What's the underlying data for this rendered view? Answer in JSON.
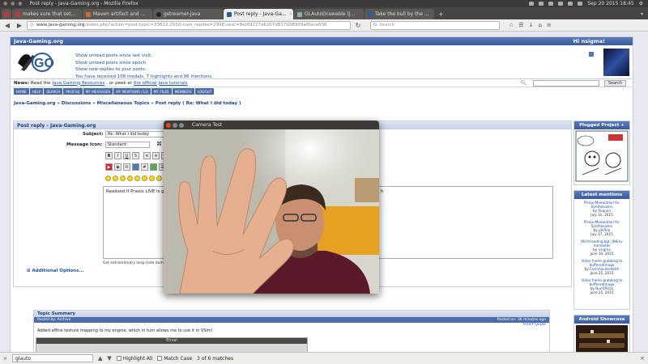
{
  "os": {
    "window_title": "Post reply - Java-Gaming.org - Mozilla Firefox",
    "clock": "Sep 20 2015 18:45"
  },
  "tabs": [
    {
      "label": "makes sure that set...",
      "icon": "gmail-icon"
    },
    {
      "label": "Maven artifact and ...",
      "icon": "maven-icon"
    },
    {
      "label": "gstreamer-java",
      "icon": "github-icon"
    },
    {
      "label": "Post reply - Java-Ga...",
      "icon": "jgo-icon",
      "active": true
    },
    {
      "label": "GLAutoDrawable (J...",
      "icon": "doc-icon"
    },
    {
      "label": "Take the bull by the ...",
      "icon": "jgo-icon"
    }
  ],
  "nav": {
    "url_host": "www.java-gaming.org",
    "url_path": "/index.php?action=post;topic=33622.2910;num_replies=2998;sesc=8e0fd227a6267d817d38909af0ace636",
    "search_placeholder": "Search"
  },
  "forum": {
    "site_name": "Java-Gaming.org",
    "greeting": "Hi nsigma!",
    "links": [
      "Show unread posts since last visit.",
      "Show unread posts since epoch.",
      "Show new replies to your posts.",
      "You have received 108 medals. 7 highlights and 96 mentions."
    ],
    "news_label": "News:",
    "news_text_1": "Read the",
    "news_link_1": "Java Gaming Resources",
    "news_text_2": ", or peek at",
    "news_link_2": "the official Java tutorials",
    "search_button": "Search",
    "menu": [
      "HOME",
      "HELP",
      "SEARCH",
      "PROFILE",
      "MY MESSAGES",
      "MY MENTIONS (13)",
      "MY FILES",
      "MEMBERS",
      "LOGOUT"
    ],
    "breadcrumb": "Java-Gaming.org » Discussions » Miscellaneous Topics » Post reply ( Re: What I did today )",
    "post_header": "Post reply - Java-Gaming.org",
    "subject_label": "Subject:",
    "subject_value": "Re: What I did today",
    "icon_label": "Message Icon:",
    "icon_value": "Standard",
    "message_text": "Realised if Praxis LIVE is ge",
    "message_text_right": "h",
    "hint": "Got extraordinary long code dumps",
    "additional_options": "Additional Options...",
    "summary_title": "Topic Summary",
    "summary_posted_by": "Posted by: Archive",
    "summary_posted_on": "Posted on: 36 minutes ago",
    "summary_insert": "Insert Quote",
    "summary_text": "Added affine texture mapping to my engine, which in turn allows me to use it in VSim!",
    "summary_screen_title": "Enval"
  },
  "sidebar": {
    "plugged_title": "Plugged Project +",
    "mentions_title": "Latest mentions",
    "mentions": [
      {
        "title": "Phase Modulation for Synthesizers",
        "by": "Roquen",
        "date": "July 31, 2015"
      },
      {
        "title": "Phase Modulation for Synthesizers",
        "by": "philfrei",
        "date": "July 27, 2015"
      },
      {
        "title": "JNI threading bgt, JNIEnv membeds",
        "by": "nsigma",
        "date": "June 30, 2015"
      },
      {
        "title": "Video frame grabbing to bufferedImage",
        "by": "CommanderKeith",
        "date": "June 25, 2015"
      },
      {
        "title": "Video frame grabbing to bufferedImage",
        "by": "BurntPizza",
        "date": "June 25, 2015"
      }
    ],
    "showcase_title": "Android Showcase"
  },
  "camera": {
    "title": "Camera Test"
  },
  "findbar": {
    "query": "glauto",
    "highlight_all": "Highlight All",
    "match_case": "Match Case",
    "matches": "3 of 6 matches"
  }
}
